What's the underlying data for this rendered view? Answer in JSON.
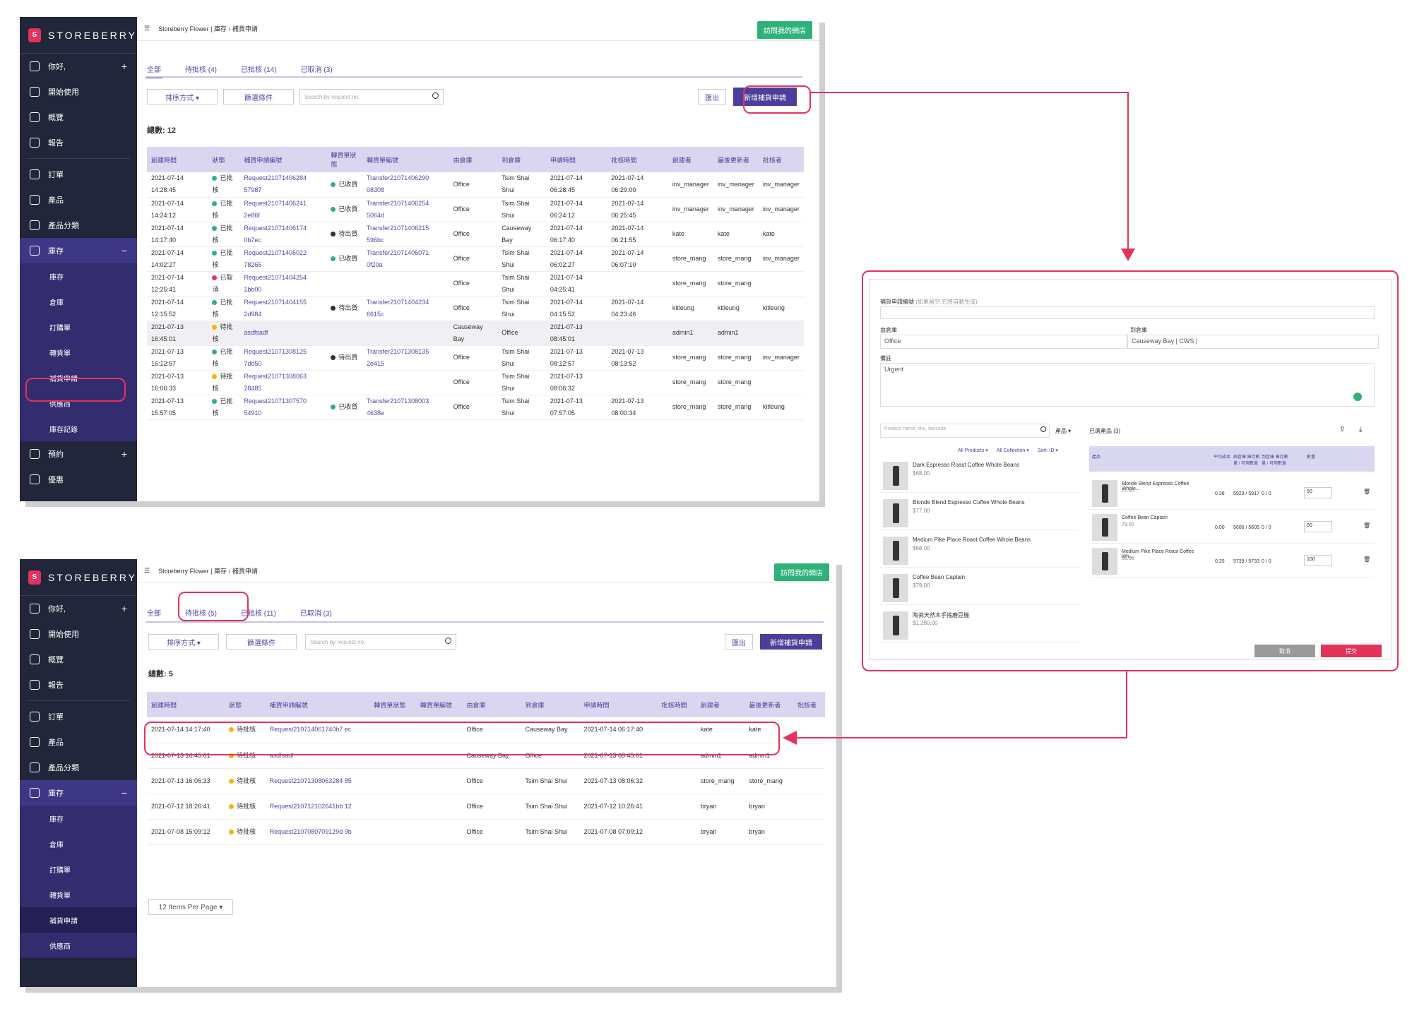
{
  "brand": {
    "name": "STOREBERRY",
    "mark": "S"
  },
  "shot1": {
    "nav": [
      {
        "label": "你好,",
        "icon": "user-icon",
        "plus": "+"
      },
      {
        "label": "開始使用",
        "icon": "flag-icon"
      },
      {
        "label": "概覽",
        "icon": "chart-icon"
      },
      {
        "label": "報告",
        "icon": "document-icon"
      },
      {
        "label": "訂單",
        "icon": "cart-icon"
      },
      {
        "label": "產品",
        "icon": "bag-icon"
      },
      {
        "label": "產品分類",
        "icon": "list-icon"
      },
      {
        "label": "庫存",
        "icon": "inventory-icon",
        "plus": "−"
      }
    ],
    "subnav": [
      "庫存",
      "倉庫",
      "訂購單",
      "轉貨單",
      "補貨申請",
      "供應商",
      "庫存記錄"
    ],
    "nav_after": [
      {
        "label": "預約",
        "icon": "calendar-icon",
        "plus": "+"
      },
      {
        "label": "優惠",
        "icon": "ticket-icon"
      }
    ],
    "breadcrumb": "Storeberry Flower  |  庫存  ›  補貨申請",
    "visit": "訪問我的網店",
    "tabs": [
      "全部",
      "待批核 (4)",
      "已批核 (14)",
      "已取消 (3)"
    ],
    "sort": "排序方式 ▾",
    "filter": "篩選條件",
    "search_placeholder": "Search by request no.",
    "export": "匯出",
    "new": "新增補貨申請",
    "total": "總數: 12",
    "headers": [
      "創建時間",
      "狀態",
      "補貨申請編號",
      "轉貨單狀態",
      "轉貨單編號",
      "由倉庫",
      "到倉庫",
      "申請時間",
      "批核時間",
      "創建者",
      "最後更新者",
      "批核者"
    ],
    "rows": [
      [
        "2021-07-14 14:28:45",
        "已批核",
        "Request21071406284 57987",
        "已收貨",
        "Transfer21071406290 08308",
        "Office",
        "Tsim Shai Shui",
        "2021-07-14 06:28:45",
        "2021-07-14 06:29:00",
        "inv_manager",
        "inv_manager",
        "inv_manager"
      ],
      [
        "2021-07-14 14:24:12",
        "已批核",
        "Request21071406241 2e86f",
        "已收貨",
        "Transfer21071406254 5064d",
        "Office",
        "Tsim Shai Shui",
        "2021-07-14 06:24:12",
        "2021-07-14 06:25:45",
        "inv_manager",
        "inv_manager",
        "inv_manager"
      ],
      [
        "2021-07-14 14:17:40",
        "已批核",
        "Request21071406174 0b7ec",
        "待出貨",
        "Transfer21071406215 596bc",
        "Office",
        "Causeway Bay",
        "2021-07-14 06:17:40",
        "2021-07-14 06:21:55",
        "kate",
        "kate",
        "kate"
      ],
      [
        "2021-07-14 14:02:27",
        "已批核",
        "Request21071406022 78265",
        "已收貨",
        "Transfer21071406071 0f20a",
        "Office",
        "Tsim Shai Shui",
        "2021-07-14 06:02:27",
        "2021-07-14 06:07:10",
        "store_mang",
        "store_mang",
        "inv_manager"
      ],
      [
        "2021-07-14 12:25:41",
        "已取消",
        "Request21071404254 1bb00",
        "",
        "",
        "Office",
        "Tsim Shai Shui",
        "2021-07-14 04:25:41",
        "",
        "store_mang",
        "store_mang",
        ""
      ],
      [
        "2021-07-14 12:15:52",
        "已批核",
        "Request21071404155 2d984",
        "待出貨",
        "Transfer21071404234 6615c",
        "Office",
        "Tsim Shai Shui",
        "2021-07-14 04:15:52",
        "2021-07-14 04:23:46",
        "kitleung",
        "kitleung",
        "kitleung"
      ],
      [
        "2021-07-13 16:45:01",
        "待批核",
        "asdfsadf",
        "",
        "",
        "Causeway Bay",
        "Office",
        "2021-07-13 08:45:01",
        "",
        "admin1",
        "admin1",
        ""
      ],
      [
        "2021-07-13 16:12:57",
        "已批核",
        "Request21071308125 7dd50",
        "待出貨",
        "Transfer21071308135 2e415",
        "Office",
        "Tsim Shai Shui",
        "2021-07-13 08:12:57",
        "2021-07-13 08:13:52",
        "store_mang",
        "store_mang",
        "inv_manager"
      ],
      [
        "2021-07-13 16:06:33",
        "待批核",
        "Request21071308063 28485",
        "",
        "",
        "Office",
        "Tsim Shai Shui",
        "2021-07-13 08:06:32",
        "",
        "store_mang",
        "store_mang",
        ""
      ],
      [
        "2021-07-13 15:57:05",
        "已批核",
        "Request21071307570 54910",
        "已收貨",
        "Transfer21071308003 4638e",
        "Office",
        "Tsim Shai Shui",
        "2021-07-13 07:57:05",
        "2021-07-13 08:00:34",
        "store_mang",
        "store_mang",
        "kitleung"
      ]
    ]
  },
  "shot2": {
    "tabs": [
      "全部",
      "待批核 (5)",
      "已批核 (11)",
      "已取消 (3)"
    ],
    "total": "總數: 5",
    "headers": [
      "創建時間",
      "狀態",
      "補貨申請編號",
      "轉貨單狀態",
      "轉貨單編號",
      "由倉庫",
      "到倉庫",
      "申請時間",
      "批核時間",
      "創建者",
      "最後更新者",
      "批核者"
    ],
    "rows": [
      [
        "2021-07-14 14:17:40",
        "待批核",
        "Request210714061740b7 ec",
        "",
        "",
        "Office",
        "Causeway Bay",
        "2021-07-14 06:17:40",
        "",
        "kate",
        "kate",
        ""
      ],
      [
        "2021-07-13 16:45:01",
        "待批核",
        "asdfsadf",
        "",
        "",
        "Causeway Bay",
        "Office",
        "2021-07-13 08:45:01",
        "",
        "admin1",
        "admin1",
        ""
      ],
      [
        "2021-07-13 16:06:33",
        "待批核",
        "Request21071308063284 85",
        "",
        "",
        "Office",
        "Tsim Shai Shui",
        "2021-07-13 08:06:32",
        "",
        "store_mang",
        "store_mang",
        ""
      ],
      [
        "2021-07-12 18:26:41",
        "待批核",
        "Request210712102641bb 12",
        "",
        "",
        "Office",
        "Tsim Shai Shui",
        "2021-07-12 10:26:41",
        "",
        "bryan",
        "bryan",
        ""
      ],
      [
        "2021-07-08 15:09:12",
        "待批核",
        "Request2107080709129d 9b",
        "",
        "",
        "Office",
        "Tsim Shai Shui",
        "2021-07-08 07:09:12",
        "",
        "bryan",
        "bryan",
        ""
      ]
    ],
    "per_page": "12 Items Per Page",
    "subnav": [
      "庫存",
      "倉庫",
      "訂購單",
      "轉貨單",
      "補貨申請",
      "供應商"
    ]
  },
  "modal": {
    "request_label": "補貨申請編號",
    "request_hint": "(如果留空,它將自動生成)",
    "from_label": "由倉庫",
    "from_value": "Office",
    "to_label": "到倉庫",
    "to_value": "Causeway Bay | CWS |",
    "remark_label": "備註",
    "remark_value": "Urgent",
    "search_placeholder": "Product name, sku, barcode",
    "search_scope": "產品 ▾",
    "filters": [
      "All Products ▾",
      "All Collection ▾",
      "Sort: ID ▾"
    ],
    "products": [
      {
        "name": "Dark Espresso Roast Coffee Whole Beans",
        "price": "$68.00"
      },
      {
        "name": "Blonde Blend Espresso Coffee Whole Beans",
        "price": "$77.00"
      },
      {
        "name": "Medium Pike Place Roast Coffee Whole Beans",
        "price": "$68.00"
      },
      {
        "name": "Coffee Bean Captain",
        "price": "$79.00"
      },
      {
        "name": "陶瓷天然木手搖磨豆機",
        "price": "$1,280.00"
      }
    ],
    "cart_title": "已選產品 (3)",
    "cart_headers": [
      "產品",
      "平均成本",
      "由倉庫 庫存數量 / 可用數量",
      "到倉庫 庫存數量 / 可用數量",
      "數量"
    ],
    "cart": [
      {
        "name": "Blonde Blend Espresso Coffee Whole...",
        "price": "77.00",
        "cost": "0.38",
        "from": "5923 / 5917",
        "to": "0 / 0",
        "qty": "50"
      },
      {
        "name": "Coffee Bean Captain",
        "price": "79.00",
        "cost": "0.00",
        "from": "5606 / 5605",
        "to": "0 / 0",
        "qty": "50"
      },
      {
        "name": "Medium Pike Place Roast Coffee Wh...",
        "price": "68.00",
        "cost": "0.25",
        "from": "5739 / 5733",
        "to": "0 / 0",
        "qty": "100"
      }
    ],
    "cancel": "取消",
    "submit": "提交"
  },
  "colors": {
    "accent": "#4b3f9b",
    "highlight": "#e2335b",
    "green": "#2fb27a"
  }
}
